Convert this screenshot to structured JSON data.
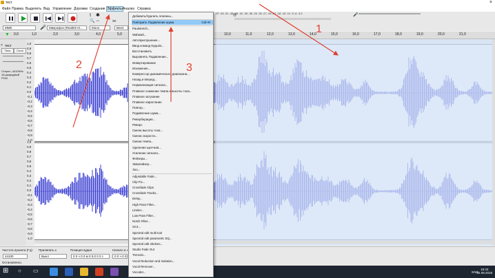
{
  "window": {
    "title": "тест",
    "close_icon": "×"
  },
  "menu": [
    "Файл",
    "Правка",
    "Выделить",
    "Вид",
    "Управление",
    "Дорожки",
    "Создание",
    "Эффекты",
    "Анализ",
    "Справка"
  ],
  "meter_scale": "-57 -54 -51 -48 -45 -42 -39 -36 -33 -30 -27 -24 -21 -18 -15 -12 -9 -6 -3 0",
  "toolbar2": {
    "host": "MME",
    "mic_device": "Микрофон (Realtek Hi...",
    "channels": "Моно",
    "output": "Bee2 Oll..."
  },
  "ruler": {
    "start": "0,0",
    "ticks": [
      "1,0",
      "2,0",
      "3,0",
      "4,0",
      "5,0",
      "6,0",
      "7,0",
      "8,0",
      "9,0",
      "10,0",
      "11,0",
      "12,0",
      "13,0",
      "14,0",
      "15,0",
      "16,0",
      "17,0",
      "18,0",
      "19,0",
      "20,0",
      "21,0"
    ]
  },
  "track": {
    "name": "тест",
    "mute_label": "Тихо",
    "solo_label": "Соло",
    "info": "Стерео, 44100Hz\n16-разрядный PCM",
    "vscale": [
      "1,0",
      "0,9",
      "0,8",
      "0,7",
      "0,6",
      "0,5",
      "0,4",
      "0,3",
      "0,2",
      "0,1",
      "0,0",
      "-0,1",
      "-0,2",
      "-0,3",
      "-0,4",
      "-0,5",
      "-0,6",
      "-0,7",
      "-0,8",
      "-0,9",
      "-1,0"
    ]
  },
  "status": {
    "rate_label": "Частота проекта (Гц):",
    "rate_value": "44100",
    "snap_label": "Прилипать к",
    "snap_value": "Выкл",
    "pos_label": "Позиция аудио",
    "pos_value": "0 0 ч 0 0 м 0 0,0 0 0 с",
    "sel_label": "Начало и конец выделения",
    "sel_value": "0 0 ч 0 0 м 0 0,0 0 0 с",
    "state": "Остановлено."
  },
  "taskbar": {
    "lang": "ENG",
    "time": "18:43",
    "date": "04.09.2018"
  },
  "effects_menu": {
    "items": [
      {
        "label": "Добавить/Удалить плагины..."
      },
      {
        "label": "Повторить Подавление шума",
        "shortcut": "Ctrl+R",
        "highlighted": true
      },
      {
        "label": "Paulstretch..."
      },
      {
        "label": "Wahwah..."
      },
      {
        "label": "Автоприглушение..."
      },
      {
        "label": "Ввод команд Nyquist..."
      },
      {
        "label": "Восстановить"
      },
      {
        "label": "Выровнять Подавление..."
      },
      {
        "label": "Инвертирование"
      },
      {
        "label": "Искажение..."
      },
      {
        "label": "Компрессор динамического диапазона..."
      },
      {
        "label": "Назад и вперед..."
      },
      {
        "label": "Нормализация сигнала..."
      },
      {
        "label": "Плавное снижение темпа и высоты тона..."
      },
      {
        "label": "Плавное затухание"
      },
      {
        "label": "Плавное нарастание"
      },
      {
        "label": "Повтор..."
      },
      {
        "label": "Подавление шума..."
      },
      {
        "label": "Реверберация..."
      },
      {
        "label": "Реверс"
      },
      {
        "label": "Смена высоты тона..."
      },
      {
        "label": "Смена скорости..."
      },
      {
        "label": "Смена темпа..."
      },
      {
        "label": "Удаление щелчков..."
      },
      {
        "label": "Усиление сигнала..."
      },
      {
        "label": "Фейзеры..."
      },
      {
        "label": "Эквалайзер..."
      },
      {
        "label": "Эхо..."
      },
      {
        "label": "Adjustable Fade..."
      },
      {
        "label": "Clip Fix..."
      },
      {
        "label": "Crossfade Clips"
      },
      {
        "label": "Crossfade Tracks..."
      },
      {
        "label": "Delay..."
      },
      {
        "label": "High Pass Filter..."
      },
      {
        "label": "Limiter..."
      },
      {
        "label": "Low Pass Filter..."
      },
      {
        "label": "Notch Filter..."
      },
      {
        "label": "SC4..."
      },
      {
        "label": "Spectral edit multi tool"
      },
      {
        "label": "Spectral edit parametric EQ..."
      },
      {
        "label": "Spectral edit shelves..."
      },
      {
        "label": "Studio Fade Out"
      },
      {
        "label": "Tremolo..."
      },
      {
        "label": "Vocal Reduction and Isolation..."
      },
      {
        "label": "Vocal Remover..."
      },
      {
        "label": "Vocoder..."
      }
    ]
  },
  "annotations": [
    "1",
    "2",
    "3"
  ],
  "colors": {
    "wave": "#3b3fd0",
    "selection": "#d2e1f5",
    "arrow": "#e04030",
    "menu_highlight": "#91c9f7"
  }
}
